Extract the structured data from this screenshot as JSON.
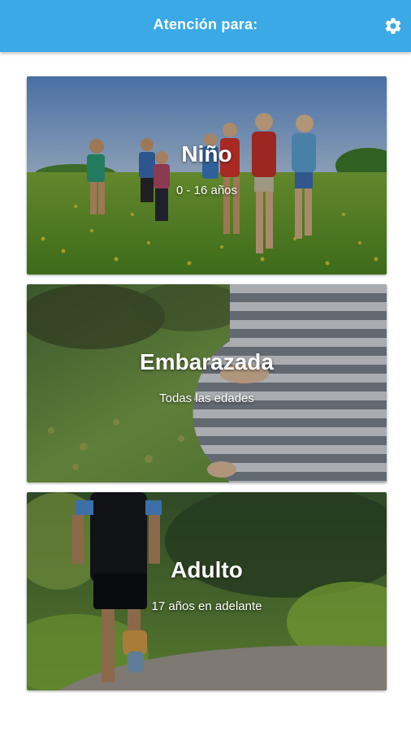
{
  "header": {
    "title": "Atención para:",
    "settings_icon": "gear-icon",
    "background_color": "#3aa9e6"
  },
  "cards": [
    {
      "title": "Niño",
      "subtitle": "0 - 16 años",
      "image": "children-running-in-meadow"
    },
    {
      "title": "Embarazada",
      "subtitle": "Todas las edades",
      "image": "pregnant-woman-belly"
    },
    {
      "title": "Adulto",
      "subtitle": "17 años en adelante",
      "image": "adult-running-on-path"
    }
  ]
}
